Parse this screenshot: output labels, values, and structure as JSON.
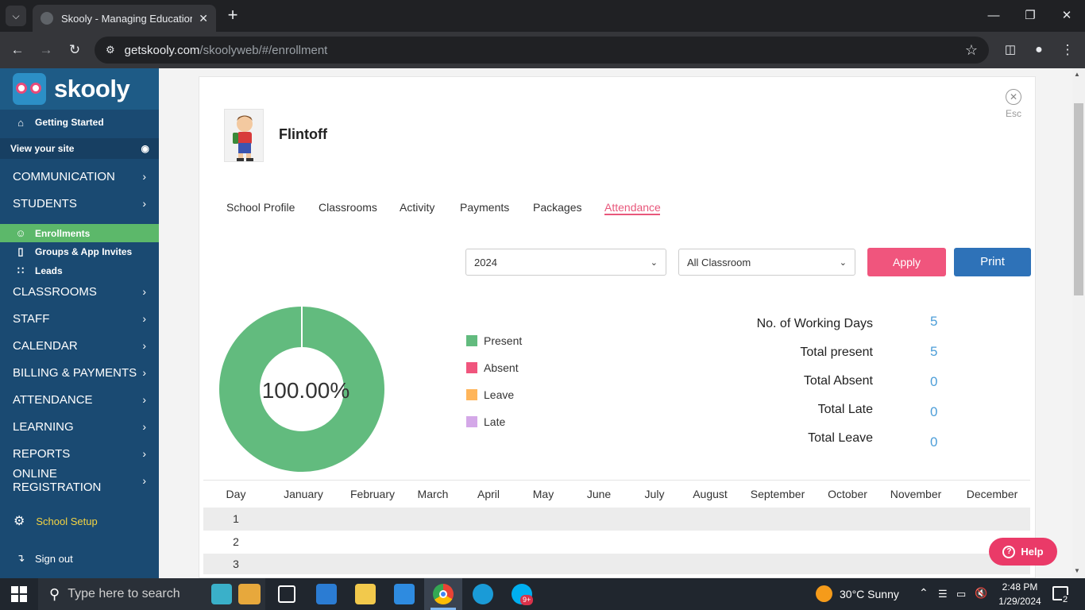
{
  "browser": {
    "tab_title": "Skooly - Managing Educational",
    "url_host": "getskooly.com",
    "url_path": "/skoolyweb/#/enrollment"
  },
  "sidebar": {
    "logo_text": "skooly",
    "getting_started": "Getting Started",
    "view_site": "View your site",
    "communication": "COMMUNICATION",
    "students": "STUDENTS",
    "enrollments": "Enrollments",
    "groups": "Groups & App Invites",
    "leads": "Leads",
    "classrooms": "CLASSROOMS",
    "staff": "STAFF",
    "calendar": "CALENDAR",
    "billing": "BILLING & PAYMENTS",
    "attendance": "ATTENDANCE",
    "learning": "LEARNING",
    "reports": "REPORTS",
    "online_registration": "ONLINE REGISTRATION",
    "school_setup": "School Setup",
    "sign_out": "Sign out"
  },
  "profile": {
    "name": "Flintoff",
    "esc_label": "Esc"
  },
  "tabs": [
    "School Profile",
    "Classrooms",
    "Activity",
    "Payments",
    "Packages",
    "Attendance"
  ],
  "filters": {
    "year": "2024",
    "classroom": "All Classroom",
    "apply_label": "Apply",
    "print_label": "Print"
  },
  "colors": {
    "present": "#62bb7e",
    "absent": "#f0557d",
    "leave": "#ffb55a",
    "late": "#d4a8e8",
    "accent": "#e8577b",
    "print": "#2e72b8"
  },
  "chart_data": {
    "type": "pie",
    "center_label": "100.00%",
    "categories": [
      "Present",
      "Absent",
      "Leave",
      "Late"
    ],
    "values": [
      5,
      0,
      0,
      0
    ]
  },
  "stats": {
    "working_days_label": "No. of Working Days",
    "working_days": "5",
    "present_label": "Total present",
    "present": "5",
    "absent_label": "Total Absent",
    "absent": "0",
    "late_label": "Total Late",
    "late": "0",
    "leave_label": "Total Leave",
    "leave": "0"
  },
  "table": {
    "headers": [
      "Day",
      "January",
      "February",
      "March",
      "April",
      "May",
      "June",
      "July",
      "August",
      "September",
      "October",
      "November",
      "December"
    ],
    "days": [
      "1",
      "2",
      "3"
    ]
  },
  "help_label": "Help",
  "taskbar": {
    "search_placeholder": "Type here to search",
    "weather": "30°C  Sunny",
    "time": "2:48 PM",
    "date": "1/29/2024",
    "notification_count": "2",
    "skype_badge": "9+"
  }
}
